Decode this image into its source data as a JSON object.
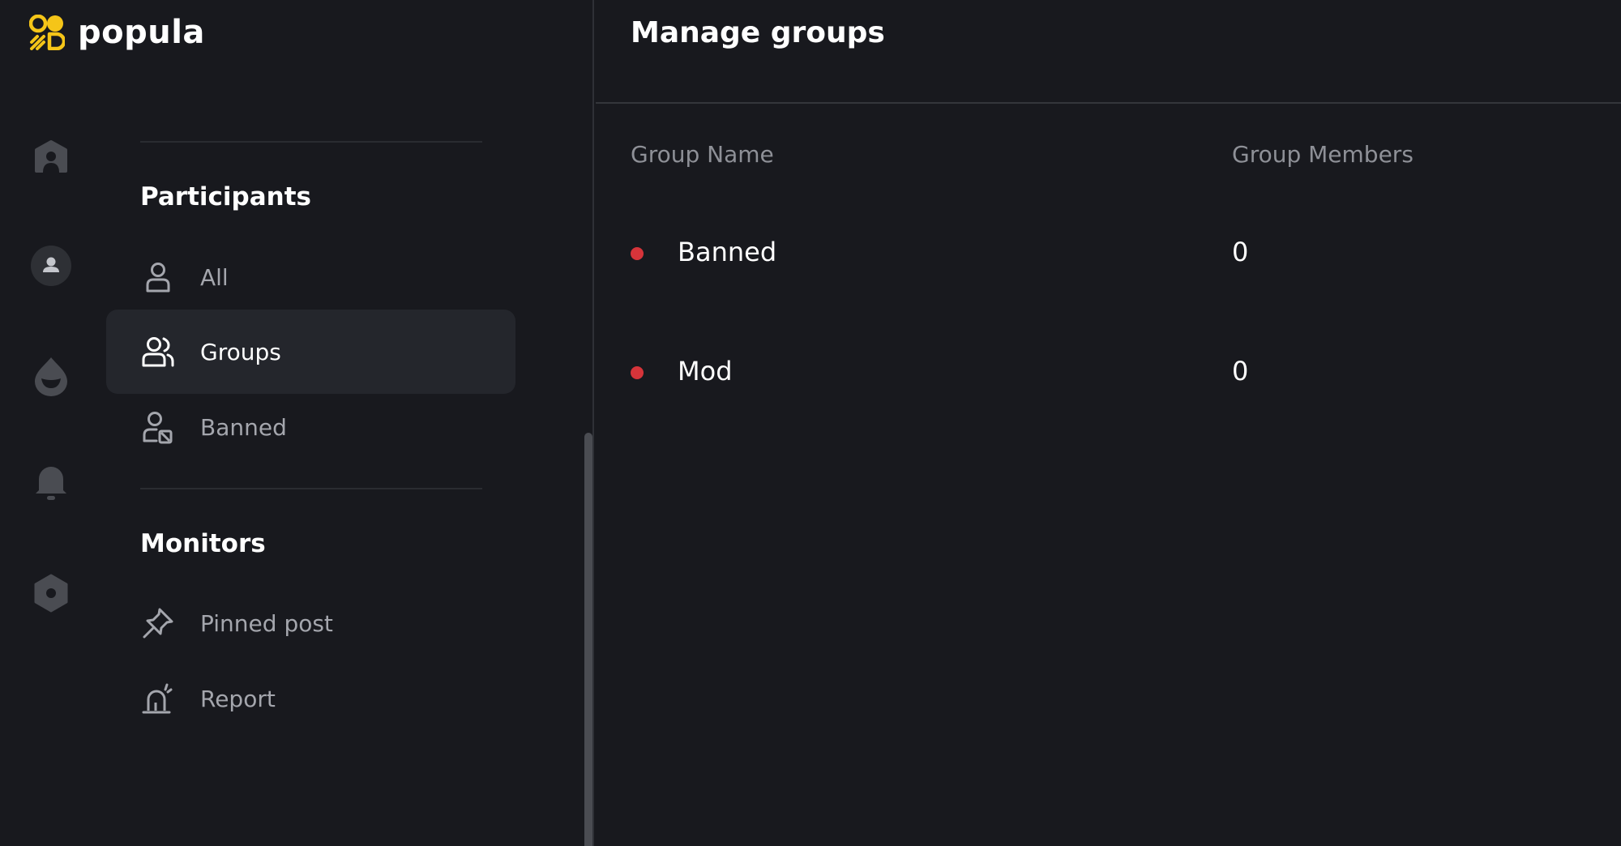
{
  "app": {
    "logo_text": "popula",
    "brand_color": "#f5c518"
  },
  "rail": {
    "icons": [
      "community-icon",
      "user-circle-icon",
      "fire-drop-icon",
      "bell-icon",
      "settings-icon"
    ]
  },
  "nav": {
    "participants": {
      "title": "Participants",
      "items": [
        {
          "label": "All",
          "icon": "user-icon"
        },
        {
          "label": "Groups",
          "icon": "users-icon",
          "active": true
        },
        {
          "label": "Banned",
          "icon": "user-banned-icon"
        }
      ]
    },
    "monitors": {
      "title": "Monitors",
      "items": [
        {
          "label": "Pinned post",
          "icon": "pin-icon"
        },
        {
          "label": "Report",
          "icon": "siren-icon"
        }
      ]
    }
  },
  "main": {
    "title": "Manage groups",
    "columns": {
      "name": "Group Name",
      "members": "Group Members"
    },
    "rows": [
      {
        "name": "Banned",
        "members": "0",
        "dot_color": "#d6343a"
      },
      {
        "name": "Mod",
        "members": "0",
        "dot_color": "#d6343a"
      }
    ]
  }
}
